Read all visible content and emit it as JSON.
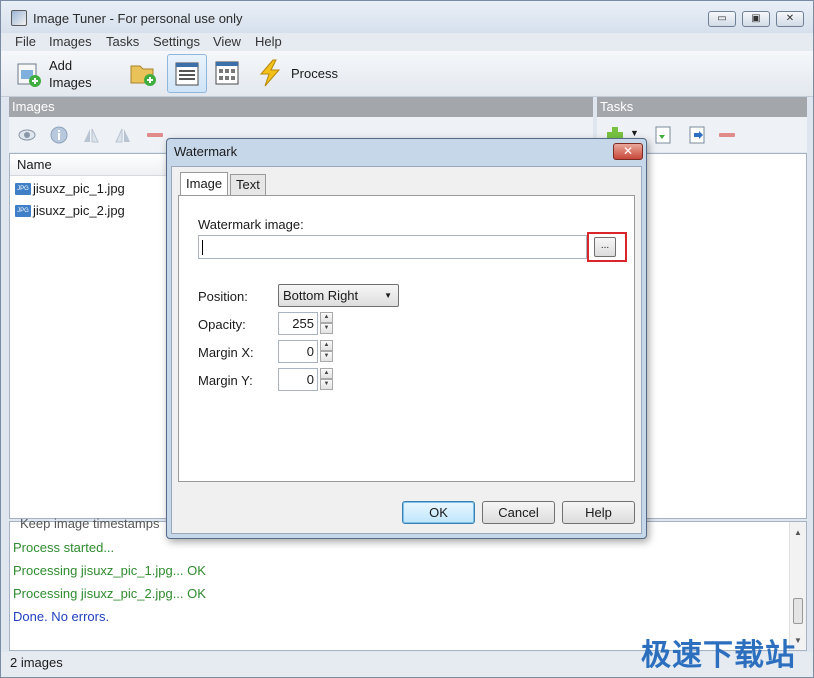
{
  "app": {
    "title": "Image Tuner - For personal use only",
    "window_controls": {
      "minimize": "▭",
      "maximize": "▣",
      "close": "✕"
    }
  },
  "menu": [
    "File",
    "Images",
    "Tasks",
    "Settings",
    "View",
    "Help"
  ],
  "toolbar": {
    "add_images_line1": "Add",
    "add_images_line2": "Images",
    "process_label": "Process"
  },
  "images_pane": {
    "header": "Images",
    "column_name": "Name",
    "files": [
      {
        "name": "jisuxz_pic_1.jpg",
        "icon": "jpg-file-icon",
        "badge": "JPG"
      },
      {
        "name": "jisuxz_pic_2.jpg",
        "icon": "jpg-file-icon",
        "badge": "JPG"
      }
    ]
  },
  "tasks_pane": {
    "header": "Tasks"
  },
  "log": {
    "partial_line": "Keep image timestamps",
    "lines": [
      {
        "text": "Process started...",
        "color": "#2e8b2e"
      },
      {
        "text": "Processing jisuxz_pic_1.jpg... OK",
        "color": "#2e8b2e"
      },
      {
        "text": "Processing jisuxz_pic_2.jpg... OK",
        "color": "#2e8b2e"
      },
      {
        "text": "Done. No errors.",
        "color": "#1f3fbf"
      }
    ]
  },
  "status": {
    "text": "2 images"
  },
  "site_watermark": "极速下载站",
  "dialog": {
    "title": "Watermark",
    "close_glyph": "✕",
    "tabs": [
      "Image",
      "Text"
    ],
    "active_tab": "Image",
    "watermark_image_label": "Watermark image:",
    "watermark_image_value": "",
    "browse_label": "...",
    "position_label": "Position:",
    "position_value": "Bottom Right",
    "opacity_label": "Opacity:",
    "opacity_value": "255",
    "margin_x_label": "Margin X:",
    "margin_x_value": "0",
    "margin_y_label": "Margin Y:",
    "margin_y_value": "0",
    "buttons": {
      "ok": "OK",
      "cancel": "Cancel",
      "help": "Help"
    }
  },
  "colors": {
    "highlight_border": "#d9262a",
    "pane_header": "#a3a6aa",
    "log_green": "#2e8b2e",
    "log_blue": "#1f3fbf"
  }
}
